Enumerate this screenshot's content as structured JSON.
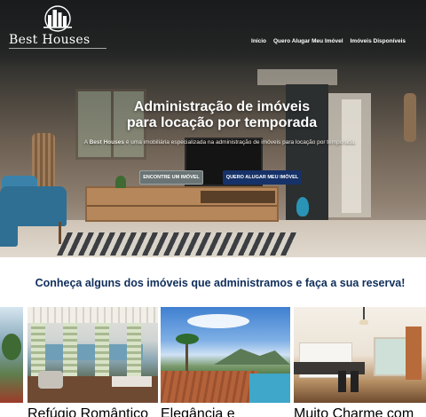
{
  "brand": {
    "name": "Best Houses"
  },
  "nav": {
    "items": [
      {
        "label": "Início"
      },
      {
        "label": "Quero Alugar Meu Imóvel"
      },
      {
        "label": "Imóveis Disponíveis"
      }
    ]
  },
  "hero": {
    "title_line1": "Administração de imóveis",
    "title_line2": "para locação por temporada",
    "subtitle_prefix": "A ",
    "subtitle_brand": "Best Houses",
    "subtitle_rest": " é uma imobiliária especializada na administração de imóveis para locação por temporada.",
    "button_find": "ENCONTRE UM IMÓVEL",
    "button_rent": "QUERO ALUGAR MEU IMÓVEL"
  },
  "properties": {
    "heading": "Conheça alguns dos imóveis que administramos e faça a sua reserva!",
    "cards": [
      {
        "caption": "Refúgio Romântico com Vista pro Mar"
      },
      {
        "caption": "Elegância e Conforto Em Frente À Praia Grande"
      },
      {
        "caption": "Muito Charme com Piscina e Varanda Gourmet"
      }
    ]
  },
  "colors": {
    "primary_button": "#163268",
    "secondary_button": "#6a7474",
    "heading": "#0f2e5b"
  }
}
